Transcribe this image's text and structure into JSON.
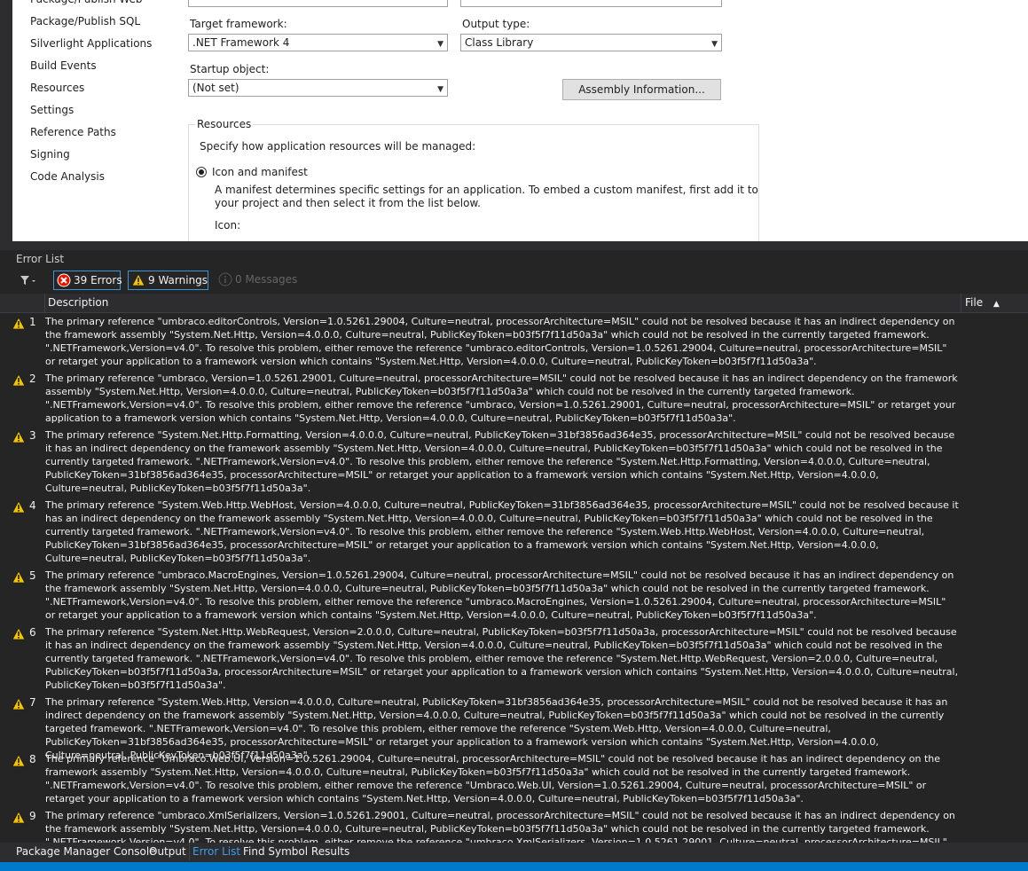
{
  "nav": {
    "items": [
      "Package/Publish Web",
      "Package/Publish SQL",
      "Silverlight Applications",
      "Build Events",
      "Resources",
      "Settings",
      "Reference Paths",
      "Signing",
      "Code Analysis"
    ]
  },
  "form": {
    "target_framework_label": "Target framework:",
    "target_framework_value": ".NET Framework 4",
    "output_type_label": "Output type:",
    "output_type_value": "Class Library",
    "startup_object_label": "Startup object:",
    "startup_object_value": "(Not set)",
    "assembly_info_button": "Assembly Information...",
    "resources_group_title": "Resources",
    "resources_desc": "Specify how application resources will be managed:",
    "icon_manifest_label": "Icon and manifest",
    "manifest_desc_1": "A manifest determines specific settings for an application. To embed a custom manifest, first add it to",
    "manifest_desc_2": "your project and then select it from the list below.",
    "icon_label": "Icon:"
  },
  "error_list": {
    "title": "Error List",
    "errors_button": "39 Errors",
    "warnings_button": "9 Warnings",
    "messages_button": "0 Messages",
    "col_description": "Description",
    "col_file": "File",
    "rows": [
      {
        "num": "1",
        "text": "The primary reference \"umbraco.editorControls, Version=1.0.5261.29004, Culture=neutral, processorArchitecture=MSIL\" could not be resolved because it has an indirect dependency on the framework assembly \"System.Net.Http, Version=4.0.0.0, Culture=neutral, PublicKeyToken=b03f5f7f11d50a3a\" which could not be resolved in the currently targeted framework. \".NETFramework,Version=v4.0\". To resolve this problem, either remove the reference \"umbraco.editorControls, Version=1.0.5261.29004, Culture=neutral, processorArchitecture=MSIL\" or retarget your application to a framework version which contains \"System.Net.Http, Version=4.0.0.0, Culture=neutral, PublicKeyToken=b03f5f7f11d50a3a\".",
        "lines": 4
      },
      {
        "num": "2",
        "text": "The primary reference \"umbraco, Version=1.0.5261.29001, Culture=neutral, processorArchitecture=MSIL\" could not be resolved because it has an indirect dependency on the framework assembly \"System.Net.Http, Version=4.0.0.0, Culture=neutral, PublicKeyToken=b03f5f7f11d50a3a\" which could not be resolved in the currently targeted framework. \".NETFramework,Version=v4.0\". To resolve this problem, either remove the reference \"umbraco, Version=1.0.5261.29001, Culture=neutral, processorArchitecture=MSIL\" or retarget your application to a framework version which contains \"System.Net.Http, Version=4.0.0.0, Culture=neutral, PublicKeyToken=b03f5f7f11d50a3a\".",
        "lines": 4
      },
      {
        "num": "3",
        "text": "The primary reference \"System.Net.Http.Formatting, Version=4.0.0.0, Culture=neutral, PublicKeyToken=31bf3856ad364e35, processorArchitecture=MSIL\" could not be resolved because it has an indirect dependency on the framework assembly \"System.Net.Http, Version=4.0.0.0, Culture=neutral, PublicKeyToken=b03f5f7f11d50a3a\" which could not be resolved in the currently targeted framework. \".NETFramework,Version=v4.0\". To resolve this problem, either remove the reference \"System.Net.Http.Formatting, Version=4.0.0.0, Culture=neutral, PublicKeyToken=31bf3856ad364e35, processorArchitecture=MSIL\" or retarget your application to a framework version which contains \"System.Net.Http, Version=4.0.0.0, Culture=neutral, PublicKeyToken=b03f5f7f11d50a3a\".",
        "lines": 5
      },
      {
        "num": "4",
        "text": "The primary reference \"System.Web.Http.WebHost, Version=4.0.0.0, Culture=neutral, PublicKeyToken=31bf3856ad364e35, processorArchitecture=MSIL\" could not be resolved because it has an indirect dependency on the framework assembly \"System.Net.Http, Version=4.0.0.0, Culture=neutral, PublicKeyToken=b03f5f7f11d50a3a\" which could not be resolved in the currently targeted framework. \".NETFramework,Version=v4.0\". To resolve this problem, either remove the reference \"System.Web.Http.WebHost, Version=4.0.0.0, Culture=neutral, PublicKeyToken=31bf3856ad364e35, processorArchitecture=MSIL\" or retarget your application to a framework version which contains \"System.Net.Http, Version=4.0.0.0, Culture=neutral, PublicKeyToken=b03f5f7f11d50a3a\".",
        "lines": 5
      },
      {
        "num": "5",
        "text": "The primary reference \"umbraco.MacroEngines, Version=1.0.5261.29004, Culture=neutral, processorArchitecture=MSIL\" could not be resolved because it has an indirect dependency on the framework assembly \"System.Net.Http, Version=4.0.0.0, Culture=neutral, PublicKeyToken=b03f5f7f11d50a3a\" which could not be resolved in the currently targeted framework. \".NETFramework,Version=v4.0\". To resolve this problem, either remove the reference \"umbraco.MacroEngines, Version=1.0.5261.29004, Culture=neutral, processorArchitecture=MSIL\" or retarget your application to a framework version which contains \"System.Net.Http, Version=4.0.0.0, Culture=neutral, PublicKeyToken=b03f5f7f11d50a3a\".",
        "lines": 4
      },
      {
        "num": "6",
        "text": "The primary reference \"System.Net.Http.WebRequest, Version=2.0.0.0, Culture=neutral, PublicKeyToken=b03f5f7f11d50a3a, processorArchitecture=MSIL\" could not be resolved because it has an indirect dependency on the framework assembly \"System.Net.Http, Version=4.0.0.0, Culture=neutral, PublicKeyToken=b03f5f7f11d50a3a\" which could not be resolved in the currently targeted framework. \".NETFramework,Version=v4.0\". To resolve this problem, either remove the reference \"System.Net.Http.WebRequest, Version=2.0.0.0, Culture=neutral, PublicKeyToken=b03f5f7f11d50a3a, processorArchitecture=MSIL\" or retarget your application to a framework version which contains \"System.Net.Http, Version=4.0.0.0, Culture=neutral, PublicKeyToken=b03f5f7f11d50a3a\".",
        "lines": 5
      },
      {
        "num": "7",
        "text": "The primary reference \"System.Web.Http, Version=4.0.0.0, Culture=neutral, PublicKeyToken=31bf3856ad364e35, processorArchitecture=MSIL\" could not be resolved because it has an indirect dependency on the framework assembly \"System.Net.Http, Version=4.0.0.0, Culture=neutral, PublicKeyToken=b03f5f7f11d50a3a\" which could not be resolved in the currently targeted framework. \".NETFramework,Version=v4.0\". To resolve this problem, either remove the reference \"System.Web.Http, Version=4.0.0.0, Culture=neutral, PublicKeyToken=31bf3856ad364e35, processorArchitecture=MSIL\" or retarget your application to a framework version which contains \"System.Net.Http, Version=4.0.0.0, Culture=neutral, PublicKeyToken=b03f5f7f11d50a3a\".",
        "lines": 4
      },
      {
        "num": "8",
        "text": "The primary reference \"Umbraco.Web.UI, Version=1.0.5261.29004, Culture=neutral, processorArchitecture=MSIL\" could not be resolved because it has an indirect dependency on the framework assembly \"System.Net.Http, Version=4.0.0.0, Culture=neutral, PublicKeyToken=b03f5f7f11d50a3a\" which could not be resolved in the currently targeted framework. \".NETFramework,Version=v4.0\". To resolve this problem, either remove the reference \"Umbraco.Web.UI, Version=1.0.5261.29004, Culture=neutral, processorArchitecture=MSIL\" or retarget your application to a framework version which contains \"System.Net.Http, Version=4.0.0.0, Culture=neutral, PublicKeyToken=b03f5f7f11d50a3a\".",
        "lines": 4
      },
      {
        "num": "9",
        "text": "The primary reference \"umbraco.XmlSerializers, Version=1.0.5261.29001, Culture=neutral, processorArchitecture=MSIL\" could not be resolved because it has an indirect dependency on the framework assembly \"System.Net.Http, Version=4.0.0.0, Culture=neutral, PublicKeyToken=b03f5f7f11d50a3a\" which could not be resolved in the currently targeted framework. \".NETFramework,Version=v4.0\". To resolve this problem, either remove the reference \"umbraco.XmlSerializers, Version=1.0.5261.29001, Culture=neutral, processorArchitecture=MSIL\" or retarget",
        "lines": 3
      }
    ]
  },
  "tabs": {
    "package_manager": "Package Manager Console",
    "output": "Output",
    "error_list": "Error List",
    "find_symbol": "Find Symbol Results"
  },
  "colors": {
    "accent": "#007acc",
    "warning": "#f5c400",
    "error": "#e51400"
  }
}
